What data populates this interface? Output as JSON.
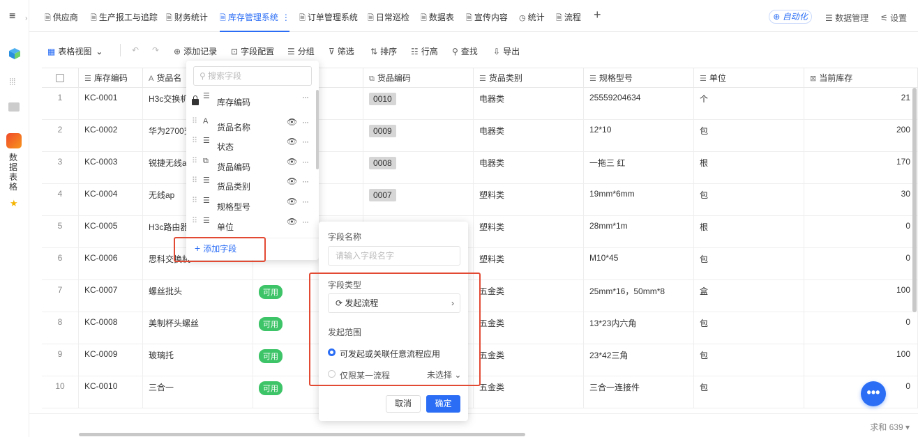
{
  "app": {
    "sidebar_title": "数据表格"
  },
  "tabs": [
    {
      "label": "供应商"
    },
    {
      "label": "生产报工与追踪"
    },
    {
      "label": "财务统计"
    },
    {
      "label": "库存管理系统"
    },
    {
      "label": "订单管理系统"
    },
    {
      "label": "日常巡检"
    },
    {
      "label": "数据表"
    },
    {
      "label": "宣传内容"
    },
    {
      "label": "统计"
    },
    {
      "label": "流程"
    }
  ],
  "topright": {
    "auto": "自动化",
    "data_manage": "数据管理",
    "settings": "设置"
  },
  "toolbar": {
    "view": "表格视图",
    "add_record": "添加记录",
    "field_config": "字段配置",
    "group": "分组",
    "filter": "筛选",
    "sort": "排序",
    "row_height": "行高",
    "find": "查找",
    "export": "导出"
  },
  "columns": [
    {
      "label": "库存编码"
    },
    {
      "label": "货品名"
    },
    {
      "label": ""
    },
    {
      "label": "货品编码"
    },
    {
      "label": "货品类别"
    },
    {
      "label": "规格型号"
    },
    {
      "label": "单位"
    },
    {
      "label": "当前库存"
    }
  ],
  "rows": [
    {
      "n": "1",
      "code": "KC-0001",
      "name": "H3c交换机",
      "status": "",
      "goods_code": "0010",
      "category": "电器类",
      "spec": "25559204634",
      "unit": "个",
      "stock": "21"
    },
    {
      "n": "2",
      "code": "KC-0002",
      "name": "华为2700交",
      "status": "",
      "goods_code": "0009",
      "category": "电器类",
      "spec": "12*10",
      "unit": "包",
      "stock": "200"
    },
    {
      "n": "3",
      "code": "KC-0003",
      "name": "锐捷无线ap",
      "status": "",
      "goods_code": "0008",
      "category": "电器类",
      "spec": "一拖三 红",
      "unit": "根",
      "stock": "170"
    },
    {
      "n": "4",
      "code": "KC-0004",
      "name": "无线ap",
      "status": "",
      "goods_code": "0007",
      "category": "塑料类",
      "spec": "19mm*6mm",
      "unit": "包",
      "stock": "30"
    },
    {
      "n": "5",
      "code": "KC-0005",
      "name": "H3c路由器",
      "status": "",
      "goods_code": "",
      "category": "塑料类",
      "spec": "28mm*1m",
      "unit": "根",
      "stock": "0"
    },
    {
      "n": "6",
      "code": "KC-0006",
      "name": "思科交换机",
      "status": "",
      "goods_code": "",
      "category": "塑料类",
      "spec": "M10*45",
      "unit": "包",
      "stock": "0"
    },
    {
      "n": "7",
      "code": "KC-0007",
      "name": "螺丝批头",
      "status": "可用",
      "goods_code": "",
      "category": "五金类",
      "spec": "25mm*16，50mm*8",
      "unit": "盒",
      "stock": "100"
    },
    {
      "n": "8",
      "code": "KC-0008",
      "name": "美制杯头螺丝",
      "status": "可用",
      "goods_code": "",
      "category": "五金类",
      "spec": "13*23内六角",
      "unit": "包",
      "stock": "0"
    },
    {
      "n": "9",
      "code": "KC-0009",
      "name": "玻璃托",
      "status": "可用",
      "goods_code": "",
      "category": "五金类",
      "spec": "23*42三角",
      "unit": "包",
      "stock": "100"
    },
    {
      "n": "10",
      "code": "KC-0010",
      "name": "三合一",
      "status": "可用",
      "goods_code": "",
      "category": "五金类",
      "spec": "三合一连接件",
      "unit": "包",
      "stock": "0"
    }
  ],
  "field_panel": {
    "search_placeholder": "搜索字段",
    "items": [
      {
        "label": "库存编码"
      },
      {
        "label": "货品名称"
      },
      {
        "label": "状态"
      },
      {
        "label": "货品编码"
      },
      {
        "label": "货品类别"
      },
      {
        "label": "规格型号"
      },
      {
        "label": "单位"
      }
    ],
    "add_field": "添加字段"
  },
  "config_panel": {
    "name_label": "字段名称",
    "name_placeholder": "请输入字段名字",
    "type_label": "字段类型",
    "type_value": "发起流程",
    "scope_label": "发起范围",
    "option1": "可发起或关联任意流程应用",
    "option2": "仅限某一流程",
    "unselected": "未选择",
    "cancel": "取消",
    "confirm": "确定"
  },
  "footer": {
    "sum": "求和 639"
  },
  "colors": {
    "accent": "#2b6ef5",
    "status_green": "#3ec468",
    "highlight_red": "#e34a33"
  }
}
